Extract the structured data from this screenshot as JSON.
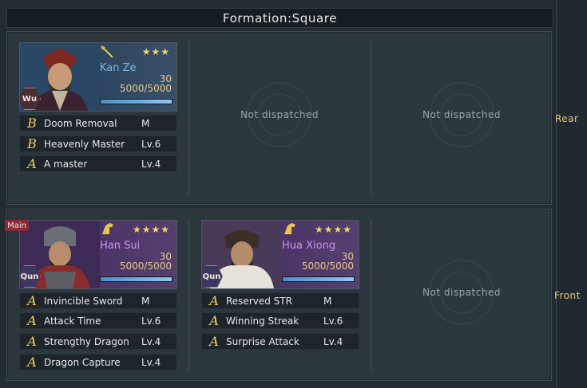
{
  "title": "Formation:Square",
  "rows": {
    "rear_label": "Rear",
    "front_label": "Front"
  },
  "empty_text": "Not dispatched",
  "heroes": {
    "kan_ze": {
      "name": "Kan Ze",
      "stars": "★★★",
      "level": "30",
      "troops": "5000/5000",
      "troop_fraction": 1.0,
      "faction": "Wu",
      "skills": [
        {
          "grade": "B",
          "name": "Doom Removal",
          "level": "M"
        },
        {
          "grade": "B",
          "name": "Heavenly Master",
          "level": "Lv.6"
        },
        {
          "grade": "A",
          "name": "A master",
          "level": "Lv.4"
        }
      ]
    },
    "han_sui": {
      "name": "Han Sui",
      "stars": "★★★★",
      "level": "30",
      "troops": "5000/5000",
      "troop_fraction": 1.0,
      "faction": "Qun",
      "badge": "Main",
      "skills": [
        {
          "grade": "A",
          "name": "Invincible Sword",
          "level": "M"
        },
        {
          "grade": "A",
          "name": "Attack Time",
          "level": "Lv.6"
        },
        {
          "grade": "A",
          "name": "Strengthy Dragon",
          "level": "Lv.4"
        },
        {
          "grade": "A",
          "name": "Dragon Capture",
          "level": "Lv.4"
        }
      ]
    },
    "hua_xiong": {
      "name": "Hua Xiong",
      "stars": "★★★★",
      "level": "30",
      "troops": "5000/5000",
      "troop_fraction": 1.0,
      "faction": "Qun",
      "skills": [
        {
          "grade": "A",
          "name": "Reserved STR",
          "level": "M"
        },
        {
          "grade": "A",
          "name": "Winning Streak",
          "level": "Lv.6"
        },
        {
          "grade": "A",
          "name": "Surprise Attack",
          "level": "Lv.4"
        }
      ]
    }
  },
  "icons": {
    "weapon_kan_ze": "spear-icon",
    "weapon_han_sui": "horse-icon",
    "weapon_hua_xiong": "horse-icon"
  }
}
